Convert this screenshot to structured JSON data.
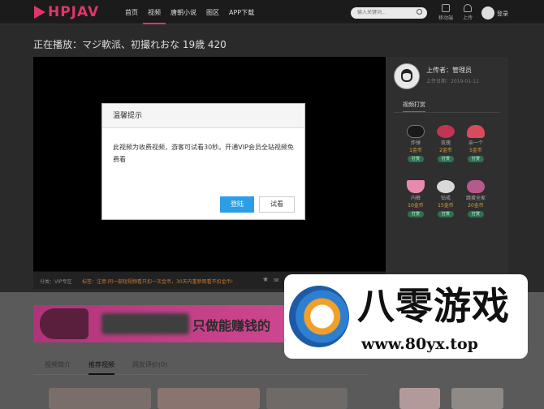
{
  "header": {
    "logo": "HPJAV",
    "nav": [
      "首页",
      "视频",
      "唐朝小说",
      "图区",
      "APP下载"
    ],
    "search_placeholder": "输入关键词...",
    "mobile_label": "移动端",
    "upload_label": "上传",
    "login_label": "登录"
  },
  "player": {
    "title": "正在播放：マジ軟派、初撮れおな 19歳 420",
    "category": "分类：VIP专区",
    "notice": "标签：注意:同一部短视频看只扣一次金币，30天内重新观看不扣金币!"
  },
  "uploader": {
    "name": "上传者：管理员",
    "date": "上传日期：2019-01-11"
  },
  "tips": {
    "header": "视频打赏",
    "button_label": "打赏",
    "gifts": [
      {
        "name": "炸弹",
        "price": "1金币"
      },
      {
        "name": "玫瑰",
        "price": "2金币"
      },
      {
        "name": "亲一个",
        "price": "5金币"
      },
      {
        "name": "内裤",
        "price": "10金币"
      },
      {
        "name": "钻戒",
        "price": "15金币"
      },
      {
        "name": "跳蛋全家",
        "price": "20金币"
      }
    ]
  },
  "modal": {
    "title": "温馨提示",
    "message": "此视频为收费视频，游客可试看30秒。开通VIP会员全站视频免费看",
    "login_button": "登陆",
    "trial_button": "试看"
  },
  "banner": {
    "text": "只做能赚钱的"
  },
  "tabs": [
    "视频简介",
    "推荐视频",
    "网友评价(0)"
  ],
  "watermark": {
    "name": "八零游戏",
    "url": "www.80yx.top"
  },
  "colors": {
    "brand": "#e0356a",
    "primary_button": "#2d9ee6",
    "tip_button": "#2f6f4f",
    "price": "#d8a13a"
  }
}
